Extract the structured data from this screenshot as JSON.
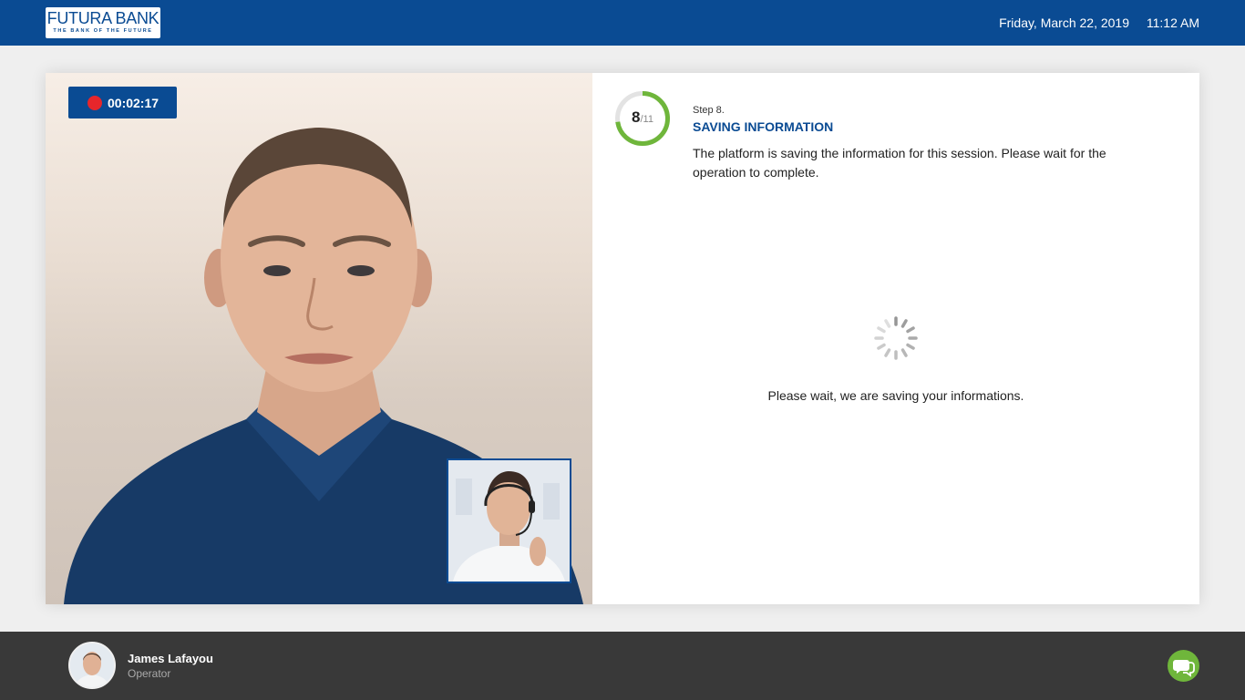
{
  "header": {
    "logo_name": "FUTURA BANK",
    "logo_tagline": "THE BANK OF THE FUTURE",
    "date": "Friday, March 22, 2019",
    "time": "11:12 AM",
    "background_color": "#0a4b93"
  },
  "video": {
    "recording_time": "00:02:17",
    "recording_indicator_color": "#e7262b",
    "main_feed_icon": "customer-video-feed",
    "pip_feed_icon": "operator-video-feed"
  },
  "step": {
    "current": "8",
    "total_label": "/11",
    "progress_fraction": 0.7273,
    "progress_color": "#6fb63b",
    "label": "Step 8.",
    "title": "SAVING INFORMATION",
    "description": "The platform is saving the information for this session. Please  wait for the operation to complete."
  },
  "status": {
    "spinner_icon": "loading-spinner",
    "message": "Please wait, we are saving your informations."
  },
  "footer": {
    "operator_name": "James Lafayou",
    "operator_role": "Operator",
    "chat_icon": "chat-bubbles-icon",
    "chat_color": "#6fb63b"
  }
}
